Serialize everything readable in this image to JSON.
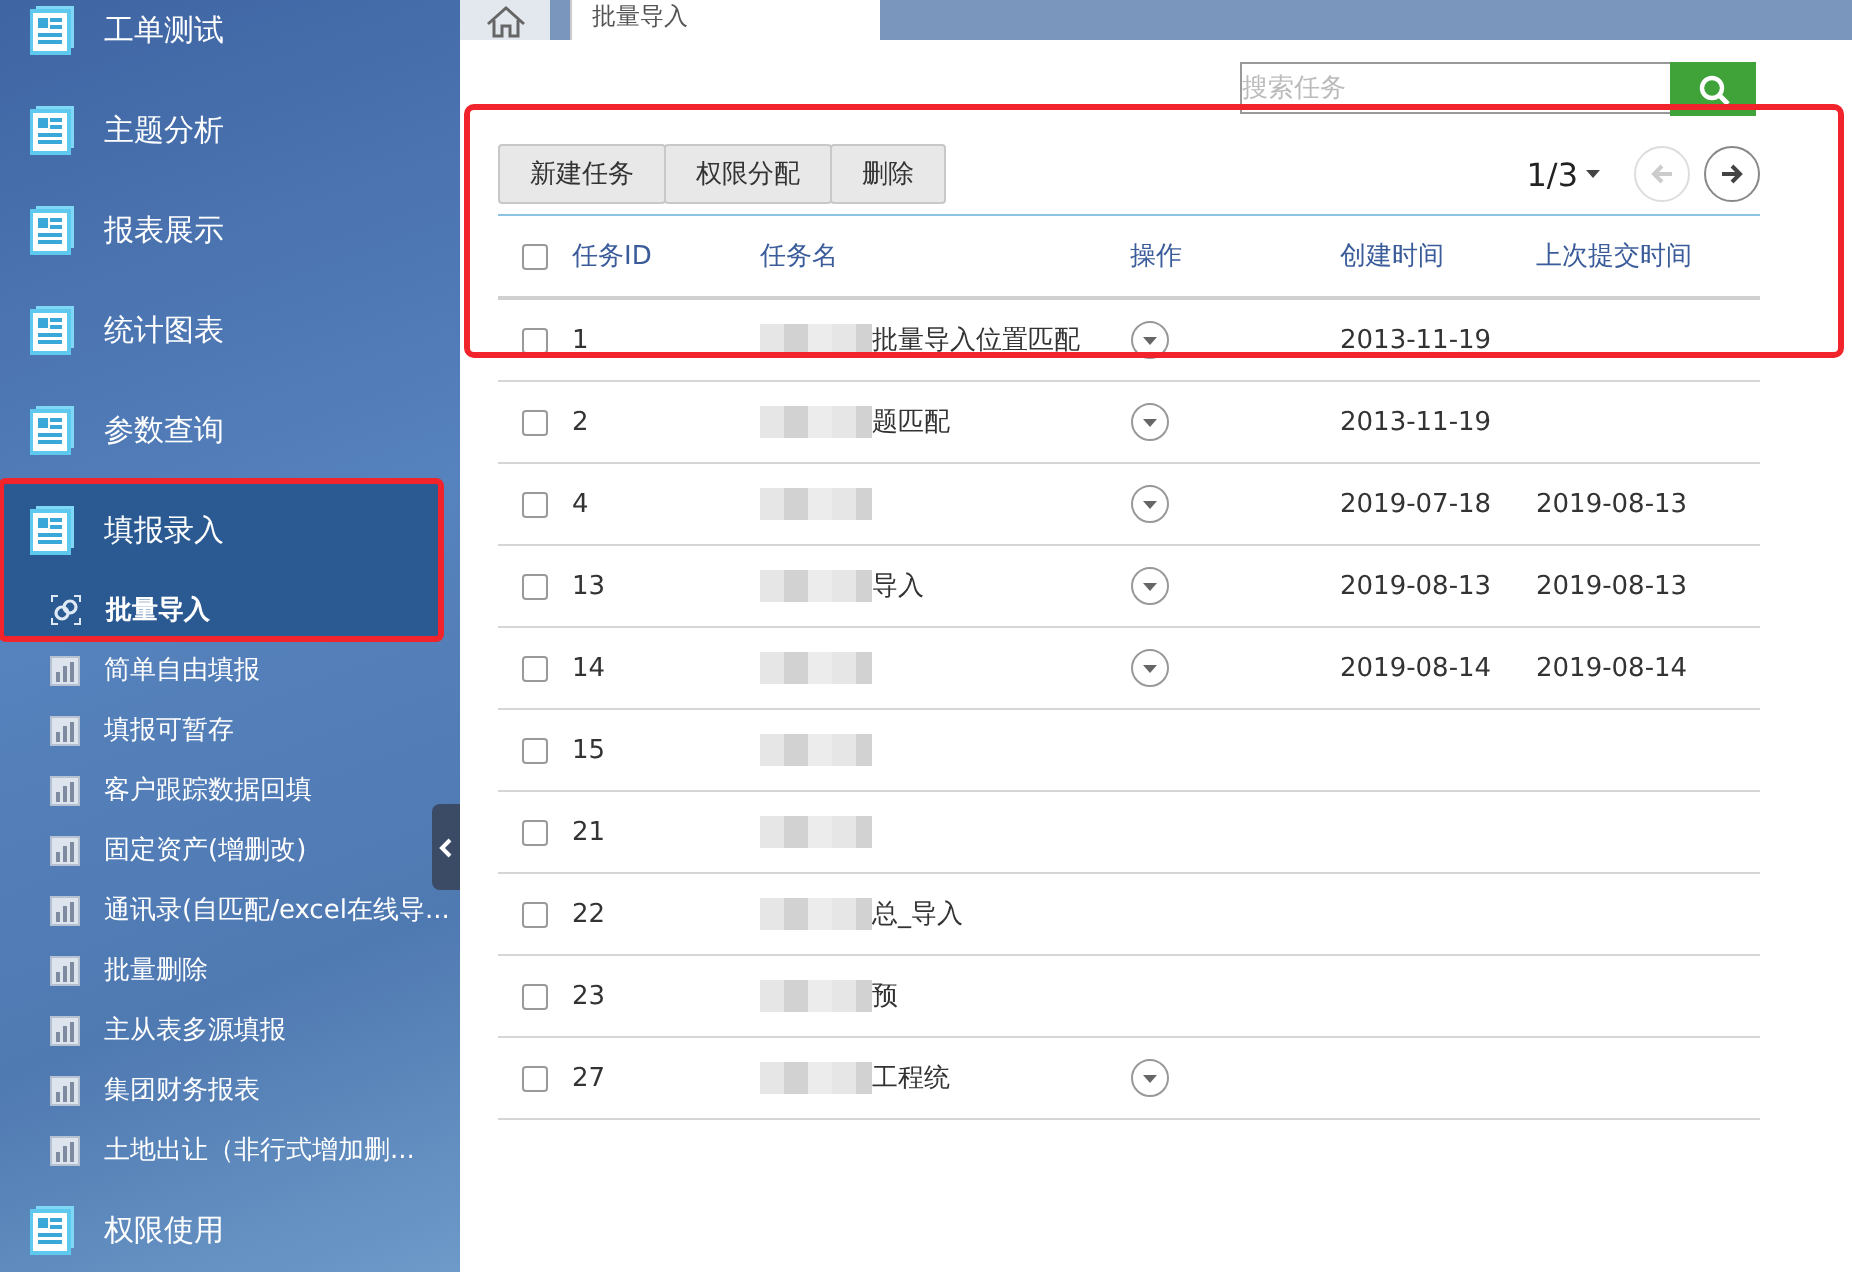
{
  "sidebar": {
    "items": [
      {
        "label": "工单测试",
        "selected": false,
        "highlighted": false
      },
      {
        "label": "主题分析",
        "selected": false,
        "highlighted": false
      },
      {
        "label": "报表展示",
        "selected": false,
        "highlighted": false
      },
      {
        "label": "统计图表",
        "selected": false,
        "highlighted": false
      },
      {
        "label": "参数查询",
        "selected": false,
        "highlighted": false
      },
      {
        "label": "填报录入",
        "selected": true,
        "highlighted": true,
        "children": [
          {
            "label": "批量导入",
            "selected": true
          },
          {
            "label": "简单自由填报",
            "selected": false
          },
          {
            "label": "填报可暂存",
            "selected": false
          },
          {
            "label": "客户跟踪数据回填",
            "selected": false
          },
          {
            "label": "固定资产(增删改)",
            "selected": false
          },
          {
            "label": "通讯录(自匹配/excel在线导...",
            "selected": false
          },
          {
            "label": "批量删除",
            "selected": false
          },
          {
            "label": "主从表多源填报",
            "selected": false
          },
          {
            "label": "集团财务报表",
            "selected": false
          },
          {
            "label": "土地出让（非行式增加删...",
            "selected": false
          }
        ]
      },
      {
        "label": "权限使用",
        "selected": false,
        "highlighted": false
      }
    ]
  },
  "tabs": [
    {
      "label": "批量导入",
      "selected": true
    }
  ],
  "search": {
    "placeholder": "搜索任务"
  },
  "toolbar": {
    "highlighted": true,
    "buttons": [
      "新建任务",
      "权限分配",
      "删除"
    ]
  },
  "pager": {
    "page": "1/3",
    "prev_disabled": true,
    "next_disabled": false
  },
  "table": {
    "select_all": false,
    "columns": [
      "任务ID",
      "任务名",
      "操作",
      "创建时间",
      "上次提交时间"
    ],
    "rows": [
      {
        "checked": false,
        "id": "1",
        "name": "批量导入位置匹配",
        "redacted": true,
        "menu": true,
        "created": "2013-11-19"
      },
      {
        "checked": false,
        "id": "2",
        "name": "题匹配",
        "redacted": true,
        "menu": true,
        "created": "2013-11-19"
      },
      {
        "checked": false,
        "id": "4",
        "redacted": true,
        "menu": true,
        "created": "2019-07-18",
        "submitted": "2019-08-13"
      },
      {
        "checked": false,
        "id": "13",
        "name": "导入",
        "redacted": true,
        "menu": true,
        "created": "2019-08-13",
        "submitted": "2019-08-13"
      },
      {
        "checked": false,
        "id": "14",
        "redacted": true,
        "menu": true,
        "created": "2019-08-14",
        "submitted": "2019-08-14"
      },
      {
        "checked": false,
        "id": "15",
        "redacted": true,
        "menu": false
      },
      {
        "checked": false,
        "id": "21",
        "redacted": true,
        "menu": false
      },
      {
        "checked": false,
        "id": "22",
        "name": "总_导入",
        "redacted": true,
        "menu": false
      },
      {
        "checked": false,
        "id": "23",
        "name": "预",
        "redacted": true,
        "menu": false
      },
      {
        "checked": false,
        "id": "27",
        "name": "工程统",
        "redacted": true,
        "menu": true
      }
    ]
  }
}
